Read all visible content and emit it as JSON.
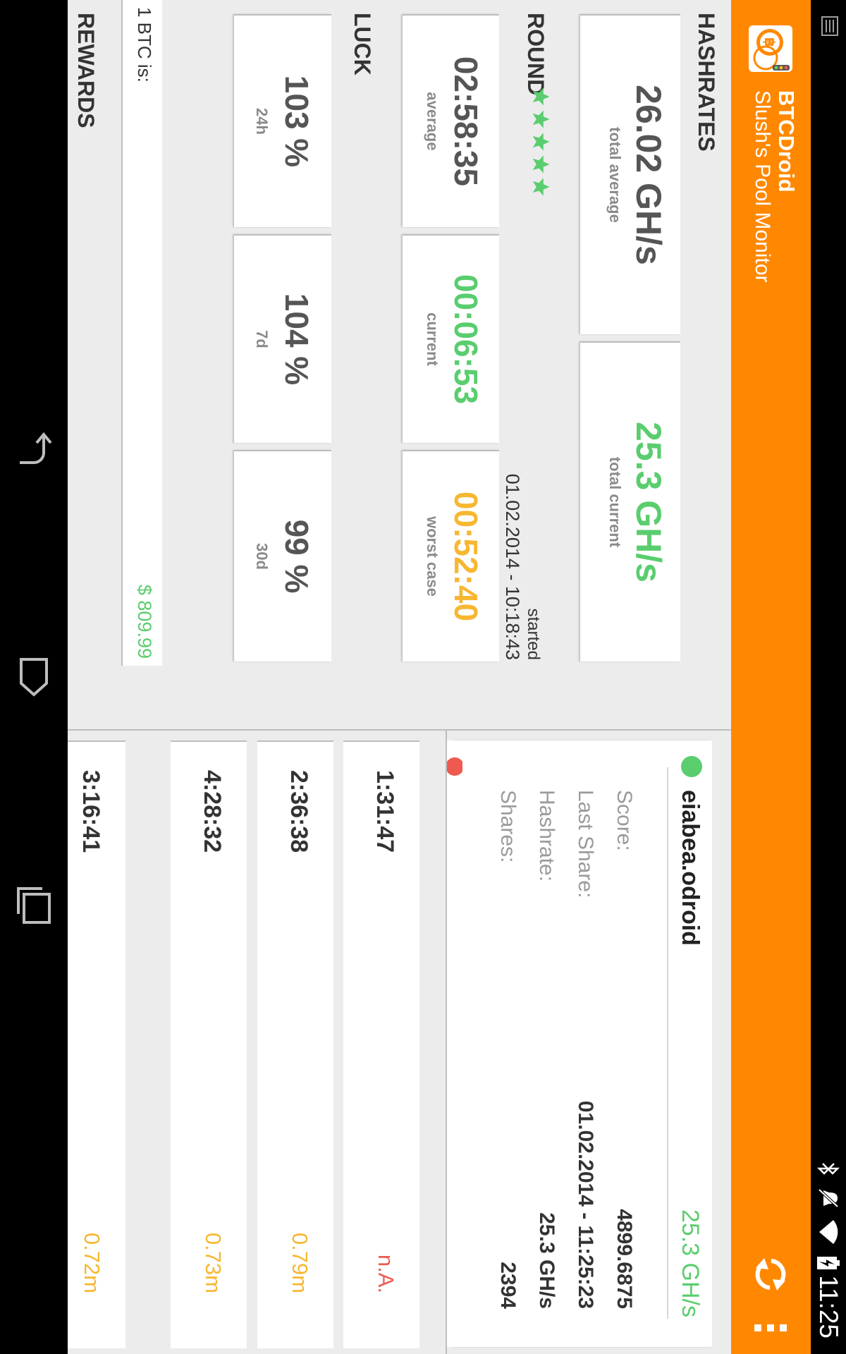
{
  "status_bar": {
    "time": "11:25",
    "icons": [
      "notification-icon",
      "bluetooth-icon",
      "mute-icon",
      "wifi-icon",
      "battery-charging-icon"
    ]
  },
  "app": {
    "title": "BTCDroid",
    "subtitle": "Slush's Pool Monitor",
    "accent_color": "#ff8800",
    "icons": [
      "app-logo-icon",
      "refresh-icon",
      "overflow-menu-icon"
    ]
  },
  "hashrates": {
    "title": "HASHRATES",
    "cards": [
      {
        "value": "26.02 GH/s",
        "label": "total average",
        "color": "default"
      },
      {
        "value": "25.3 GH/s",
        "label": "total current",
        "color": "green"
      }
    ]
  },
  "round": {
    "title": "ROUND",
    "stars": 5,
    "started_label": "started",
    "started_value": "01.02.2014 - 10:18:43",
    "cards": [
      {
        "value": "02:58:35",
        "label": "average",
        "color": "default"
      },
      {
        "value": "00:06:53",
        "label": "current",
        "color": "green"
      },
      {
        "value": "00:52:40",
        "label": "worst case",
        "color": "orange"
      }
    ]
  },
  "luck": {
    "title": "LUCK",
    "cards": [
      {
        "value": "103 %",
        "label": "24h"
      },
      {
        "value": "104 %",
        "label": "7d"
      },
      {
        "value": "99 %",
        "label": "30d"
      }
    ]
  },
  "btc_price": {
    "label": "1 BTC is:",
    "value": "$ 809.99",
    "color": "#5acd6e"
  },
  "rewards": {
    "title": "REWARDS"
  },
  "worker": {
    "status_color": "#5acd6e",
    "name": "eiabea.odroid",
    "hashrate_header": "25.3 GH/s",
    "rows": [
      {
        "label": "Score:",
        "value": "4899.6875"
      },
      {
        "label": "Last Share:",
        "value": "01.02.2014 - 11:25:23"
      },
      {
        "label": "Hashrate:",
        "value": "25.3 GH/s"
      },
      {
        "label": "Shares:",
        "value": "2394"
      }
    ],
    "second_status_color": "#ee5a4f"
  },
  "blocks": [
    {
      "time": "1:31:47",
      "reward": "n.A.",
      "reward_color": "red"
    },
    {
      "time": "2:36:38",
      "reward": "0.79m",
      "reward_color": "orange"
    },
    {
      "time": "4:28:32",
      "reward": "0.73m",
      "reward_color": "orange"
    },
    {
      "time": "3:16:41",
      "reward": "0.72m",
      "reward_color": "orange"
    }
  ],
  "nav": {
    "icons": [
      "back-icon",
      "home-icon",
      "recent-apps-icon"
    ]
  }
}
